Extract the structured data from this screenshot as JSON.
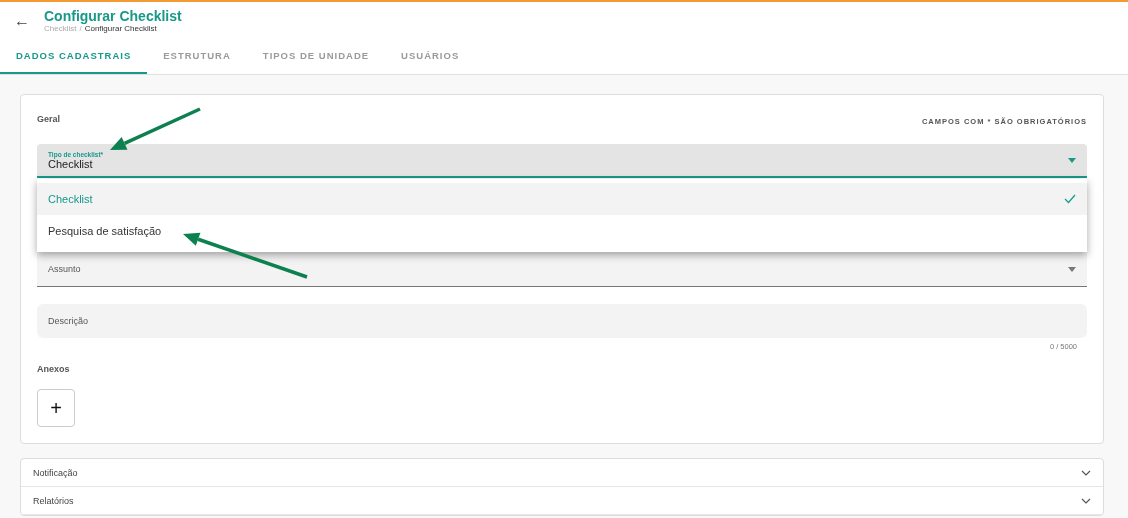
{
  "header": {
    "back": "←",
    "title": "Configurar Checklist",
    "breadcrumb": [
      {
        "label": "Checklist",
        "current": false
      },
      {
        "label": "Configurar Checklist",
        "current": true
      }
    ],
    "separator": "/"
  },
  "tabs": [
    {
      "label": "DADOS CADASTRAIS",
      "selected": true
    },
    {
      "label": "ESTRUTURA",
      "selected": false
    },
    {
      "label": "TIPOS DE UNIDADE",
      "selected": false
    },
    {
      "label": "USUÁRIOS",
      "selected": false
    }
  ],
  "general": {
    "title": "Geral",
    "required_note": "CAMPOS COM * SÃO OBRIGATÓRIOS",
    "type_select": {
      "label": "Tipo de checklist*",
      "value": "Checklist",
      "expanded": true,
      "options": [
        {
          "label": "Checklist",
          "selected": true
        },
        {
          "label": "Pesquisa de satisfação",
          "selected": false
        }
      ]
    },
    "subject": {
      "placeholder": "Assunto"
    },
    "description": {
      "placeholder": "Descrição",
      "counter": "0 / 5000"
    },
    "attachments": {
      "title": "Anexos",
      "add": "+"
    }
  },
  "panels": [
    {
      "title": "Notificação",
      "expanded": false
    },
    {
      "title": "Relatórios",
      "expanded": false
    }
  ]
}
